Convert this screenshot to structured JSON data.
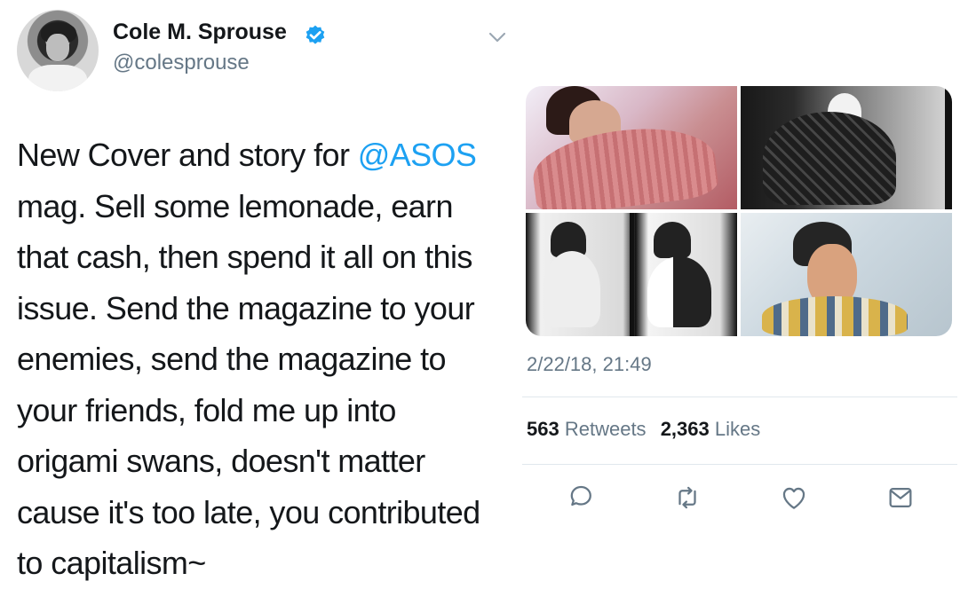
{
  "author": {
    "name": "Cole M. Sprouse",
    "handle": "@colesprouse"
  },
  "tweet": {
    "lines": [
      [
        {
          "text": "New Cover and story for "
        },
        {
          "text": "@ASOS",
          "mention": true
        }
      ],
      [
        {
          "text": "mag. Sell some lemonade, earn"
        }
      ],
      [
        {
          "text": "that cash, then spend it all on this"
        }
      ],
      [
        {
          "text": "issue. Send the magazine to your"
        }
      ],
      [
        {
          "text": "enemies, send the magazine to"
        }
      ],
      [
        {
          "text": "your friends, fold me up into"
        }
      ],
      [
        {
          "text": "origami swans, doesn't matter"
        }
      ],
      [
        {
          "text": "cause it's too late, you contributed"
        }
      ],
      [
        {
          "text": "to capitalism~"
        }
      ]
    ]
  },
  "timestamp": "2/22/18, 21:49",
  "stats": {
    "retweets_count": "563",
    "retweets_label": "Retweets",
    "likes_count": "2,363",
    "likes_label": "Likes"
  },
  "colors": {
    "text": "#14171a",
    "secondary": "#657786",
    "accent": "#1da1f2",
    "divider": "#e1e8ed"
  },
  "icons": [
    "verified-icon",
    "chevron-down-icon",
    "reply-icon",
    "retweet-icon",
    "like-icon",
    "share-icon"
  ]
}
